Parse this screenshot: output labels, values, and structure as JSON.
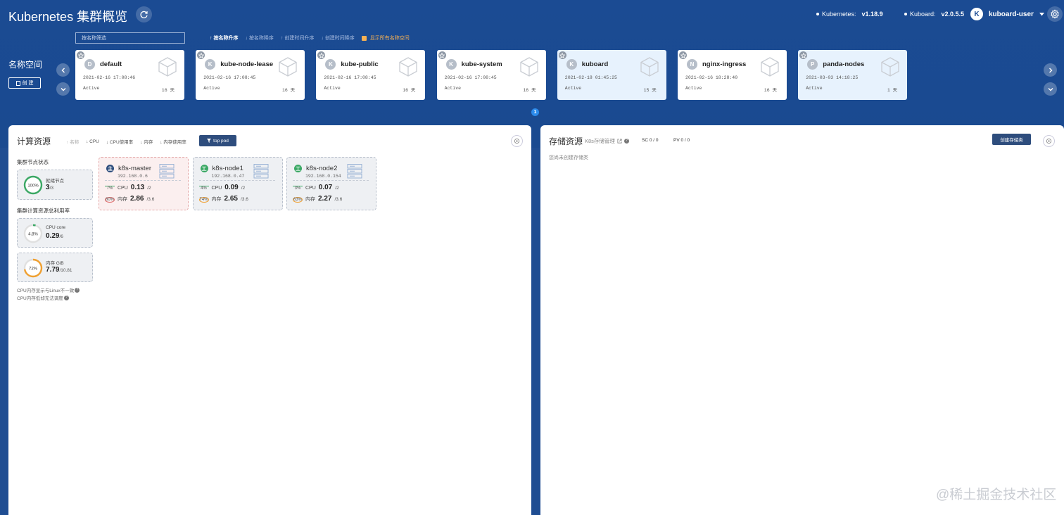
{
  "header": {
    "title": "Kubernetes 集群概览",
    "kubernetes_label": "Kubernetes:",
    "kubernetes_version": "v1.18.9",
    "kuboard_label": "Kuboard:",
    "kuboard_version": "v2.0.5.5",
    "user_initial": "K",
    "user_name": "kuboard-user"
  },
  "namespace_bar": {
    "label": "名称空间",
    "create_label": "创 建",
    "filter_placeholder": "按名称筛选",
    "sort_options": [
      "按名称升序",
      "按名称降序",
      "创建时间升序",
      "创建时间降序"
    ],
    "show_all_label": "显示所有名称空间",
    "page": "1",
    "namespaces": [
      {
        "initial": "D",
        "name": "default",
        "created": "2021-02-16 17:08:46",
        "status": "Active",
        "age": "16 天",
        "highlighted": false
      },
      {
        "initial": "K",
        "name": "kube-node-lease",
        "created": "2021-02-16 17:08:45",
        "status": "Active",
        "age": "16 天",
        "highlighted": false
      },
      {
        "initial": "K",
        "name": "kube-public",
        "created": "2021-02-16 17:08:45",
        "status": "Active",
        "age": "16 天",
        "highlighted": false
      },
      {
        "initial": "K",
        "name": "kube-system",
        "created": "2021-02-16 17:08:45",
        "status": "Active",
        "age": "16 天",
        "highlighted": false
      },
      {
        "initial": "K",
        "name": "kuboard",
        "created": "2021-02-18 01:45:25",
        "status": "Active",
        "age": "15 天",
        "highlighted": true
      },
      {
        "initial": "N",
        "name": "nginx-ingress",
        "created": "2021-02-16 18:28:40",
        "status": "Active",
        "age": "16 天",
        "highlighted": false
      },
      {
        "initial": "P",
        "name": "panda-nodes",
        "created": "2021-03-03 14:18:25",
        "status": "Active",
        "age": "1 天",
        "highlighted": true
      }
    ]
  },
  "compute": {
    "title": "计算资源",
    "sort_options": [
      "名称",
      "CPU",
      "CPU使用率",
      "内存",
      "内存使用率"
    ],
    "top_pod_label": "top pod",
    "cluster_node_status_label": "集群节点状态",
    "ready_nodes": {
      "percent": "100%",
      "label": "就绪节点",
      "value": "3",
      "total": "/3",
      "fraction": 1.0
    },
    "cluster_usage_label": "集群计算资源总利用率",
    "cpu_total": {
      "percent": "4.8%",
      "label": "CPU core",
      "value": "0.29",
      "total": "/6",
      "fraction": 0.048
    },
    "mem_total": {
      "percent": "72%",
      "label": "内存 GiB",
      "value": "7.79",
      "total": "/10.81",
      "fraction": 0.72
    },
    "note_1": "CPU内存显示与Linux不一致",
    "note_2": "CPU内存低却无法调度",
    "nodes": [
      {
        "badge": "主",
        "name": "k8s-master",
        "ip": "192.168.0.6",
        "cpu_pct": "7%",
        "cpu": "0.13",
        "cpu_total": "/2",
        "mem_pct": "80%",
        "mem": "2.86",
        "mem_total": "/3.6",
        "role": "master"
      },
      {
        "badge": "工",
        "name": "k8s-node1",
        "ip": "192.168.0.47",
        "cpu_pct": "4%",
        "cpu": "0.09",
        "cpu_total": "/2",
        "mem_pct": "74%",
        "mem": "2.65",
        "mem_total": "/3.6",
        "role": "worker"
      },
      {
        "badge": "工",
        "name": "k8s-node2",
        "ip": "192.168.0.154",
        "cpu_pct": "3%",
        "cpu": "0.07",
        "cpu_total": "/2",
        "mem_pct": "63%",
        "mem": "2.27",
        "mem_total": "/3.6",
        "role": "worker"
      }
    ],
    "cpu_label": "CPU",
    "mem_label": "内存"
  },
  "storage": {
    "title": "存储资源",
    "subtitle": "K8s存储管理",
    "sc_count": "SC 0 / 0",
    "pv_count": "PV 0 / 0",
    "create_label": "创建存储类",
    "empty_text": "您尚未创建存储类"
  },
  "watermark": "@稀土掘金技术社区",
  "colors": {
    "header_bg": "#1b4b93",
    "accent_blue": "#2b8aeb",
    "ok_green": "#3aa864",
    "warn_orange": "#f0a030",
    "master_red": "#e06a6a"
  }
}
